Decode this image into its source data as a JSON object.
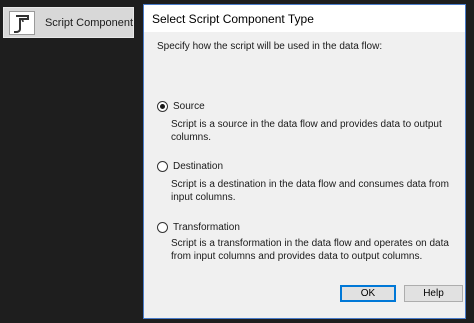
{
  "toolbox": {
    "item_label": "Script Component",
    "item_icon": "script-icon"
  },
  "dialog": {
    "title": "Select Script Component Type",
    "instruction": "Specify how the script will be used in the data flow:",
    "options": [
      {
        "label": "Source",
        "selected": true,
        "description": "Script is a source in the data flow and provides data to output columns."
      },
      {
        "label": "Destination",
        "selected": false,
        "description": "Script is a destination in the data flow and consumes data from input columns."
      },
      {
        "label": "Transformation",
        "selected": false,
        "description": "Script is a transformation in the data flow and operates on data from input columns and provides data to output columns."
      }
    ],
    "buttons": {
      "ok_label": "OK",
      "help_label": "Help"
    }
  },
  "colors": {
    "background": "#1e1e1e",
    "dialog_border": "#4a7cc9",
    "default_button_border": "#0078d7"
  }
}
